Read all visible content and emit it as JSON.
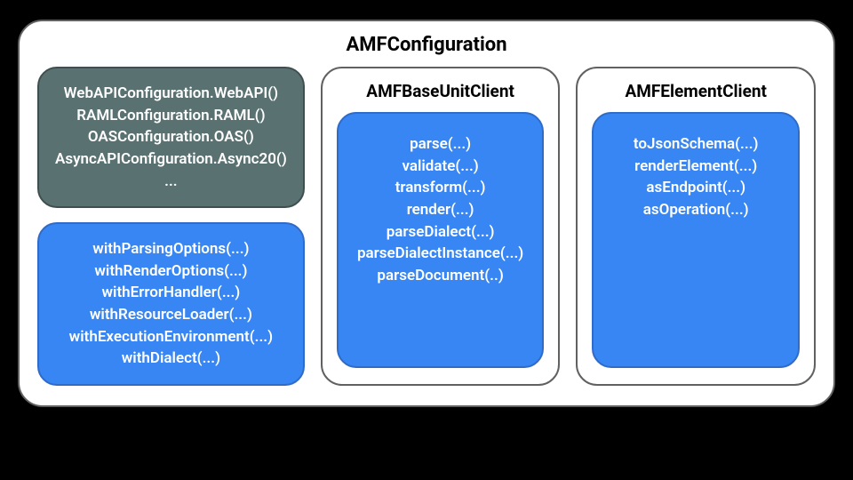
{
  "outer": {
    "title": "AMFConfiguration"
  },
  "left_grey": {
    "lines": [
      "WebAPIConfiguration.WebAPI()",
      "RAMLConfiguration.RAML()",
      "OASConfiguration.OAS()",
      "AsyncAPIConfiguration.Async20()",
      "..."
    ]
  },
  "left_blue": {
    "lines": [
      "withParsingOptions(...)",
      "withRenderOptions(...)",
      "withErrorHandler(...)",
      "withResourceLoader(...)",
      "withExecutionEnvironment(...)",
      "withDialect(...)"
    ]
  },
  "mid": {
    "title": "AMFBaseUnitClient",
    "lines": [
      "parse(...)",
      "validate(...)",
      "transform(...)",
      "render(...)",
      "parseDialect(...)",
      "parseDialectInstance(...)",
      "parseDocument(..)"
    ]
  },
  "right": {
    "title": "AMFElementClient",
    "lines": [
      "toJsonSchema(...)",
      "renderElement(...)",
      "asEndpoint(...)",
      "asOperation(...)"
    ]
  }
}
